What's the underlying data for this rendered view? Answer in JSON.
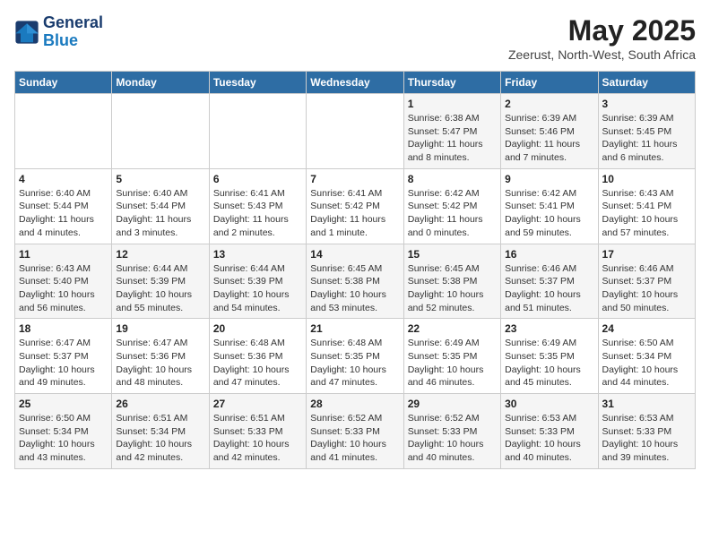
{
  "logo": {
    "line1": "General",
    "line2": "Blue"
  },
  "title": "May 2025",
  "subtitle": "Zeerust, North-West, South Africa",
  "days_of_week": [
    "Sunday",
    "Monday",
    "Tuesday",
    "Wednesday",
    "Thursday",
    "Friday",
    "Saturday"
  ],
  "weeks": [
    [
      {
        "day": "",
        "info": ""
      },
      {
        "day": "",
        "info": ""
      },
      {
        "day": "",
        "info": ""
      },
      {
        "day": "",
        "info": ""
      },
      {
        "day": "1",
        "info": "Sunrise: 6:38 AM\nSunset: 5:47 PM\nDaylight: 11 hours and 8 minutes."
      },
      {
        "day": "2",
        "info": "Sunrise: 6:39 AM\nSunset: 5:46 PM\nDaylight: 11 hours and 7 minutes."
      },
      {
        "day": "3",
        "info": "Sunrise: 6:39 AM\nSunset: 5:45 PM\nDaylight: 11 hours and 6 minutes."
      }
    ],
    [
      {
        "day": "4",
        "info": "Sunrise: 6:40 AM\nSunset: 5:44 PM\nDaylight: 11 hours and 4 minutes."
      },
      {
        "day": "5",
        "info": "Sunrise: 6:40 AM\nSunset: 5:44 PM\nDaylight: 11 hours and 3 minutes."
      },
      {
        "day": "6",
        "info": "Sunrise: 6:41 AM\nSunset: 5:43 PM\nDaylight: 11 hours and 2 minutes."
      },
      {
        "day": "7",
        "info": "Sunrise: 6:41 AM\nSunset: 5:42 PM\nDaylight: 11 hours and 1 minute."
      },
      {
        "day": "8",
        "info": "Sunrise: 6:42 AM\nSunset: 5:42 PM\nDaylight: 11 hours and 0 minutes."
      },
      {
        "day": "9",
        "info": "Sunrise: 6:42 AM\nSunset: 5:41 PM\nDaylight: 10 hours and 59 minutes."
      },
      {
        "day": "10",
        "info": "Sunrise: 6:43 AM\nSunset: 5:41 PM\nDaylight: 10 hours and 57 minutes."
      }
    ],
    [
      {
        "day": "11",
        "info": "Sunrise: 6:43 AM\nSunset: 5:40 PM\nDaylight: 10 hours and 56 minutes."
      },
      {
        "day": "12",
        "info": "Sunrise: 6:44 AM\nSunset: 5:39 PM\nDaylight: 10 hours and 55 minutes."
      },
      {
        "day": "13",
        "info": "Sunrise: 6:44 AM\nSunset: 5:39 PM\nDaylight: 10 hours and 54 minutes."
      },
      {
        "day": "14",
        "info": "Sunrise: 6:45 AM\nSunset: 5:38 PM\nDaylight: 10 hours and 53 minutes."
      },
      {
        "day": "15",
        "info": "Sunrise: 6:45 AM\nSunset: 5:38 PM\nDaylight: 10 hours and 52 minutes."
      },
      {
        "day": "16",
        "info": "Sunrise: 6:46 AM\nSunset: 5:37 PM\nDaylight: 10 hours and 51 minutes."
      },
      {
        "day": "17",
        "info": "Sunrise: 6:46 AM\nSunset: 5:37 PM\nDaylight: 10 hours and 50 minutes."
      }
    ],
    [
      {
        "day": "18",
        "info": "Sunrise: 6:47 AM\nSunset: 5:37 PM\nDaylight: 10 hours and 49 minutes."
      },
      {
        "day": "19",
        "info": "Sunrise: 6:47 AM\nSunset: 5:36 PM\nDaylight: 10 hours and 48 minutes."
      },
      {
        "day": "20",
        "info": "Sunrise: 6:48 AM\nSunset: 5:36 PM\nDaylight: 10 hours and 47 minutes."
      },
      {
        "day": "21",
        "info": "Sunrise: 6:48 AM\nSunset: 5:35 PM\nDaylight: 10 hours and 47 minutes."
      },
      {
        "day": "22",
        "info": "Sunrise: 6:49 AM\nSunset: 5:35 PM\nDaylight: 10 hours and 46 minutes."
      },
      {
        "day": "23",
        "info": "Sunrise: 6:49 AM\nSunset: 5:35 PM\nDaylight: 10 hours and 45 minutes."
      },
      {
        "day": "24",
        "info": "Sunrise: 6:50 AM\nSunset: 5:34 PM\nDaylight: 10 hours and 44 minutes."
      }
    ],
    [
      {
        "day": "25",
        "info": "Sunrise: 6:50 AM\nSunset: 5:34 PM\nDaylight: 10 hours and 43 minutes."
      },
      {
        "day": "26",
        "info": "Sunrise: 6:51 AM\nSunset: 5:34 PM\nDaylight: 10 hours and 42 minutes."
      },
      {
        "day": "27",
        "info": "Sunrise: 6:51 AM\nSunset: 5:33 PM\nDaylight: 10 hours and 42 minutes."
      },
      {
        "day": "28",
        "info": "Sunrise: 6:52 AM\nSunset: 5:33 PM\nDaylight: 10 hours and 41 minutes."
      },
      {
        "day": "29",
        "info": "Sunrise: 6:52 AM\nSunset: 5:33 PM\nDaylight: 10 hours and 40 minutes."
      },
      {
        "day": "30",
        "info": "Sunrise: 6:53 AM\nSunset: 5:33 PM\nDaylight: 10 hours and 40 minutes."
      },
      {
        "day": "31",
        "info": "Sunrise: 6:53 AM\nSunset: 5:33 PM\nDaylight: 10 hours and 39 minutes."
      }
    ]
  ]
}
